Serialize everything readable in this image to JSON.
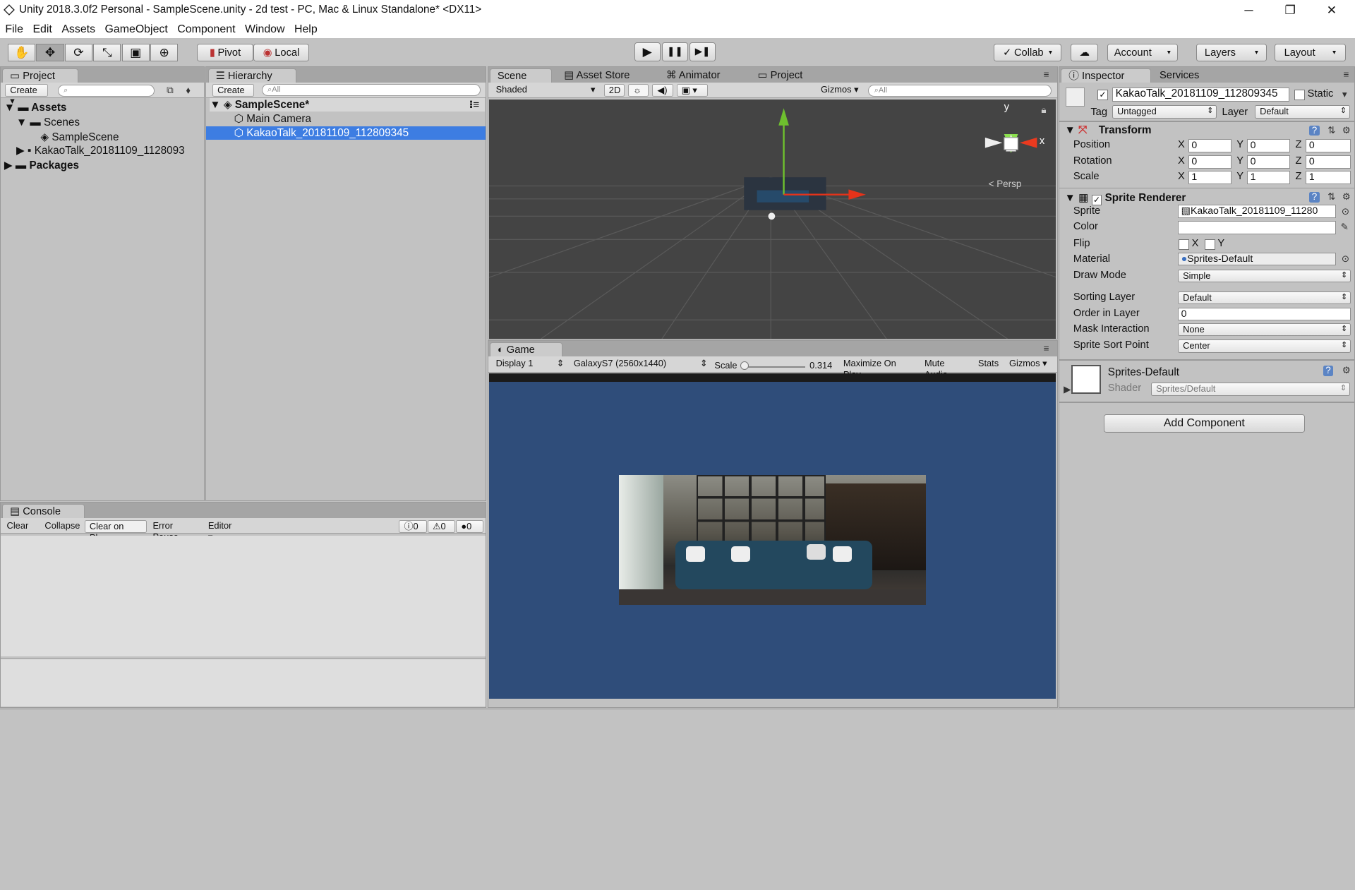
{
  "window": {
    "title": "Unity 2018.3.0f2 Personal - SampleScene.unity - 2d test - PC, Mac & Linux Standalone* <DX11>",
    "minimize": "─",
    "restore": "❐",
    "close": "✕"
  },
  "menu": [
    "File",
    "Edit",
    "Assets",
    "GameObject",
    "Component",
    "Window",
    "Help"
  ],
  "toolbar": {
    "tools": [
      "✋",
      "✥",
      "⟳",
      "⤡",
      "▣",
      "⊕"
    ],
    "pivot": "Pivot",
    "local": "Local",
    "play": "▶",
    "pause": "❚❚",
    "step": "▶❚",
    "collab": "Collab",
    "cloud": "☁",
    "account": "Account",
    "layers": "Layers",
    "layout": "Layout"
  },
  "project": {
    "tab": "Project",
    "create": "Create",
    "items": [
      "Assets",
      "Scenes",
      "SampleScene",
      "KakaoTalk_20181109_1128093",
      "Packages"
    ]
  },
  "hierarchy": {
    "tab": "Hierarchy",
    "create": "Create",
    "search": "All",
    "scene": "SampleScene*",
    "items": [
      "Main Camera",
      "KakaoTalk_20181109_112809345"
    ]
  },
  "scene": {
    "tabs": [
      "Scene",
      "Asset Store",
      "Animator",
      "Project"
    ],
    "shaded": "Shaded",
    "mode2d": "2D",
    "gizmos": "Gizmos",
    "search": "All",
    "persp": "Persp",
    "axis_y": "y",
    "axis_x": "x"
  },
  "game": {
    "tab": "Game",
    "display": "Display 1",
    "resolution": "GalaxyS7 (2560x1440)",
    "scale_label": "Scale",
    "scale_value": "0.314",
    "maximize": "Maximize On Play",
    "mute": "Mute Audio",
    "stats": "Stats",
    "gizmos": "Gizmos",
    "bg": "#2f4d7a"
  },
  "console": {
    "tab": "Console",
    "clear": "Clear",
    "collapse": "Collapse",
    "clear_on_play": "Clear on Play",
    "error_pause": "Error Pause",
    "editor": "Editor",
    "count_info": "0",
    "count_warn": "0",
    "count_err": "0"
  },
  "inspector": {
    "tabs": [
      "Inspector",
      "Services"
    ],
    "object_name": "KakaoTalk_20181109_112809345",
    "static": "Static",
    "tag_label": "Tag",
    "tag": "Untagged",
    "layer_label": "Layer",
    "layer": "Default",
    "transform": {
      "title": "Transform",
      "position": "Position",
      "rotation": "Rotation",
      "scale": "Scale",
      "pos": [
        "0",
        "0",
        "0"
      ],
      "rot": [
        "0",
        "0",
        "0"
      ],
      "scl": [
        "1",
        "1",
        "1"
      ],
      "x": "X",
      "y": "Y",
      "z": "Z"
    },
    "sprite_renderer": {
      "title": "Sprite Renderer",
      "sprite_label": "Sprite",
      "sprite": "KakaoTalk_20181109_11280",
      "color_label": "Color",
      "flip_label": "Flip",
      "flip_x": "X",
      "flip_y": "Y",
      "material_label": "Material",
      "material": "Sprites-Default",
      "draw_mode_label": "Draw Mode",
      "draw_mode": "Simple",
      "sorting_layer_label": "Sorting Layer",
      "sorting_layer": "Default",
      "order_label": "Order in Layer",
      "order": "0",
      "mask_label": "Mask Interaction",
      "mask": "None",
      "sort_point_label": "Sprite Sort Point",
      "sort_point": "Center"
    },
    "material": {
      "name": "Sprites-Default",
      "shader_label": "Shader",
      "shader": "Sprites/Default"
    },
    "add_component": "Add Component"
  }
}
